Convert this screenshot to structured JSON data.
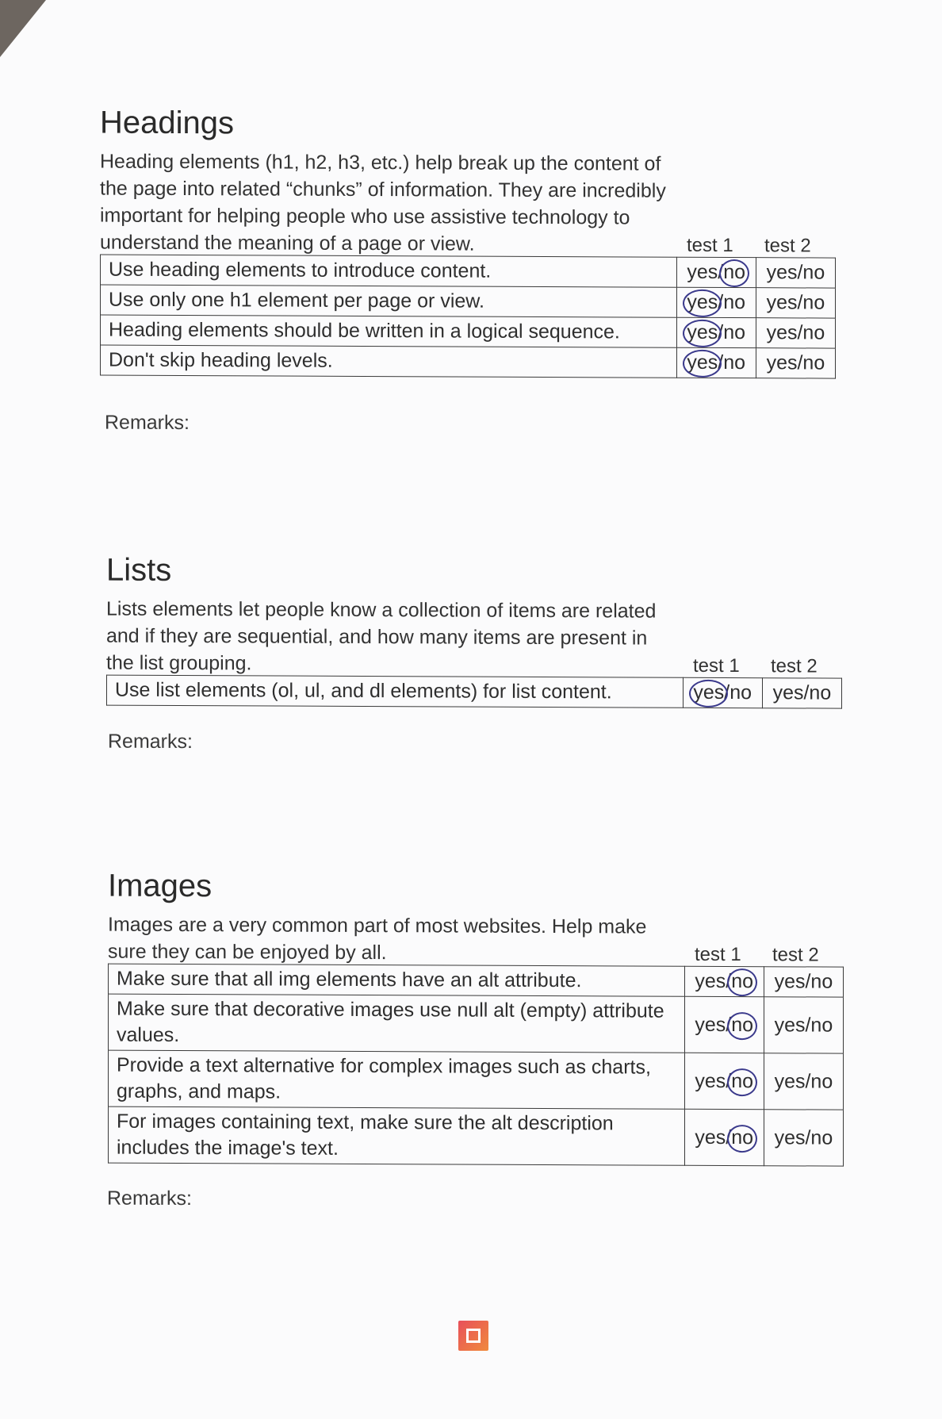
{
  "headings": {
    "title": "Headings",
    "description": "Heading elements (h1, h2, h3, etc.) help break up the content of the page into related “chunks” of information. They are incredibly important for helping people who use assistive technology to understand the meaning of a page or view.",
    "test1_label": "test 1",
    "test2_label": "test 2",
    "rows": [
      {
        "criterion": "Use heading elements to introduce content.",
        "test1_circled": "no",
        "test2": "yes/no"
      },
      {
        "criterion": "Use only one h1 element per page or view.",
        "test1_circled": "yes",
        "test2": "yes/no"
      },
      {
        "criterion": "Heading elements should be written in a logical sequence.",
        "test1_circled": "yes",
        "test2": "yes/no"
      },
      {
        "criterion": "Don't skip heading levels.",
        "test1_circled": "yes",
        "test2": "yes/no"
      }
    ],
    "remarks_label": "Remarks:"
  },
  "lists": {
    "title": "Lists",
    "description": "Lists elements let people know a collection of items are related and if they are sequential, and how many items are present in the list grouping.",
    "test1_label": "test 1",
    "test2_label": "test 2",
    "rows": [
      {
        "criterion": "Use list elements (ol, ul, and dl elements) for list content.",
        "test1_circled": "yes",
        "test2": "yes/no"
      }
    ],
    "remarks_label": "Remarks:"
  },
  "images": {
    "title": "Images",
    "description": "Images are a very common part of most websites. Help make sure they can be enjoyed by all.",
    "test1_label": "test 1",
    "test2_label": "test 2",
    "rows": [
      {
        "criterion": "Make sure that all img elements have an alt attribute.",
        "test1_circled": "no",
        "test2": "yes/no"
      },
      {
        "criterion": "Make sure that decorative images use null alt (empty) attribute values.",
        "test1_circled": "no",
        "test2": "yes/no"
      },
      {
        "criterion": "Provide a text alternative for complex images such as charts, graphs, and maps.",
        "test1_circled": "no",
        "test2": "yes/no"
      },
      {
        "criterion": "For images containing text, make sure the alt description includes the image's text.",
        "test1_circled": "no",
        "test2": "yes/no"
      }
    ],
    "remarks_label": "Remarks:"
  },
  "answer_tokens": {
    "yes": "yes",
    "slash": "/",
    "no": "no"
  },
  "colors": {
    "pen": "#3b3a8c",
    "logo_start": "#e8505b",
    "logo_end": "#f08a3c"
  }
}
